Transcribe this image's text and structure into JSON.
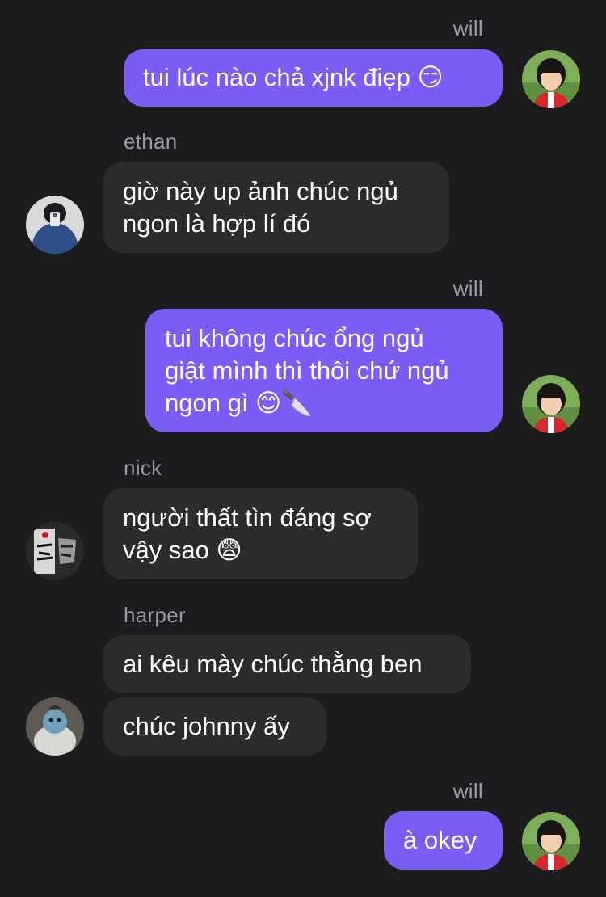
{
  "messages": [
    {
      "sender": "will",
      "text": "tui lúc nào chả xjnk điẹp 😏"
    },
    {
      "sender": "ethan",
      "text": "giờ này up ảnh chúc ngủ\nngon là hợp lí đó"
    },
    {
      "sender": "will",
      "text": "tui không chúc ổng ngủ\ngiật mình thì thôi chứ ngủ\nngon gì 😊🔪"
    },
    {
      "sender": "nick",
      "text": "người thất tìn đáng sợ\nvậy sao 😨"
    },
    {
      "sender": "harper",
      "text": "ai kêu mày chúc thằng ben"
    },
    {
      "sender": "harper",
      "text": "chúc johnny ấy"
    },
    {
      "sender": "will",
      "text": "à okey"
    }
  ],
  "colors": {
    "background": "#1c1c1e",
    "outgoing_bubble": "#7b5cf5",
    "incoming_bubble": "#2c2c2e",
    "sender_name": "#9a9aa0"
  },
  "avatars": {
    "will": "child-portrait-avatar",
    "ethan": "person-hoodie-avatar",
    "nick": "graffiti-avatar",
    "harper": "snowman-avatar"
  }
}
